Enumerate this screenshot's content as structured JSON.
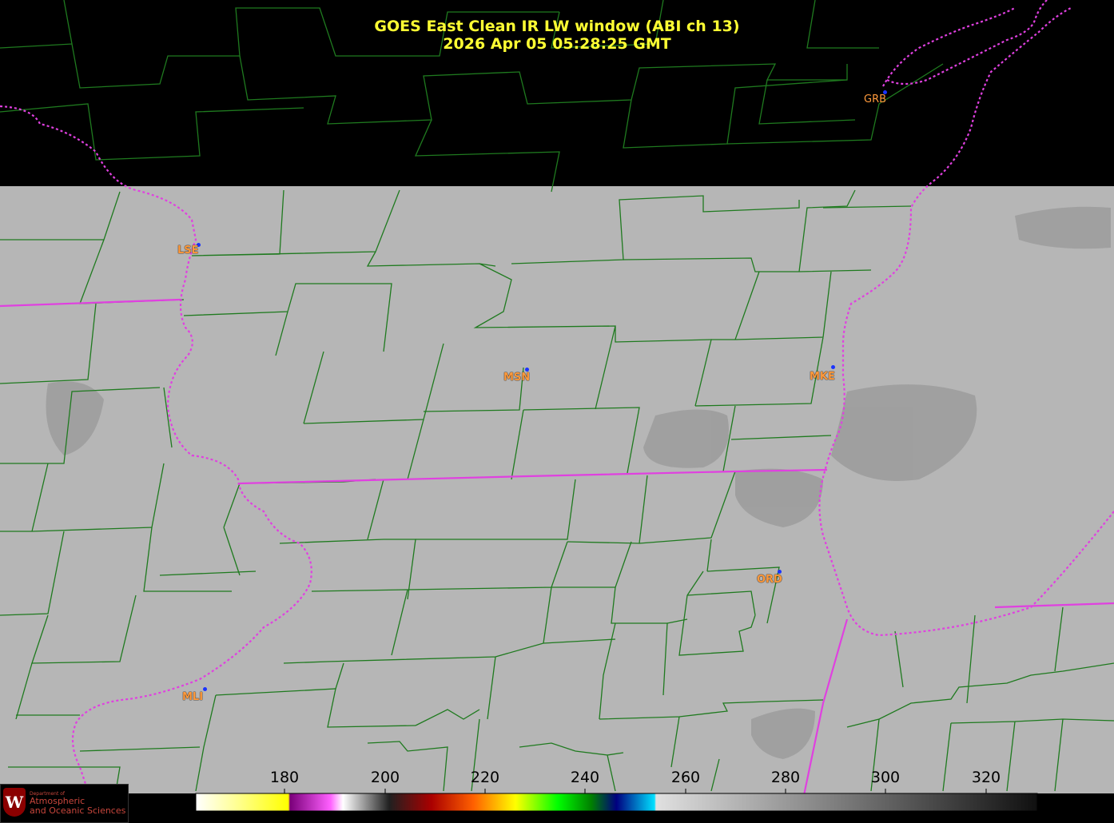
{
  "title": {
    "line1": "GOES East Clean IR LW window (ABI ch 13)",
    "line2": "2026 Apr 05  05:28:25 GMT"
  },
  "stations": [
    {
      "code": "GRB",
      "color": "#ff9a3c"
    },
    {
      "code": "LSE",
      "color": "#ff9a3c"
    },
    {
      "code": "MSN",
      "color": "#ff9a3c"
    },
    {
      "code": "MKE",
      "color": "#ff9a3c"
    },
    {
      "code": "ORD",
      "color": "#ff9a3c"
    },
    {
      "code": "MLI",
      "color": "#ff9a3c"
    }
  ],
  "colorbar": {
    "tick_labels": [
      "180",
      "200",
      "220",
      "240",
      "260",
      "280",
      "300",
      "320"
    ],
    "range": [
      163,
      330
    ]
  },
  "logo": {
    "small_text": "Department of",
    "line1": "Atmospheric",
    "line2": "and Oceanic Sciences",
    "seal_letter": "W"
  },
  "colors": {
    "title": "#ffff33",
    "county_lines": "#1f7a1f",
    "state_lines": "#e040e0",
    "background_cloud_free": "#b4b4b4",
    "no_data": "#000000"
  }
}
